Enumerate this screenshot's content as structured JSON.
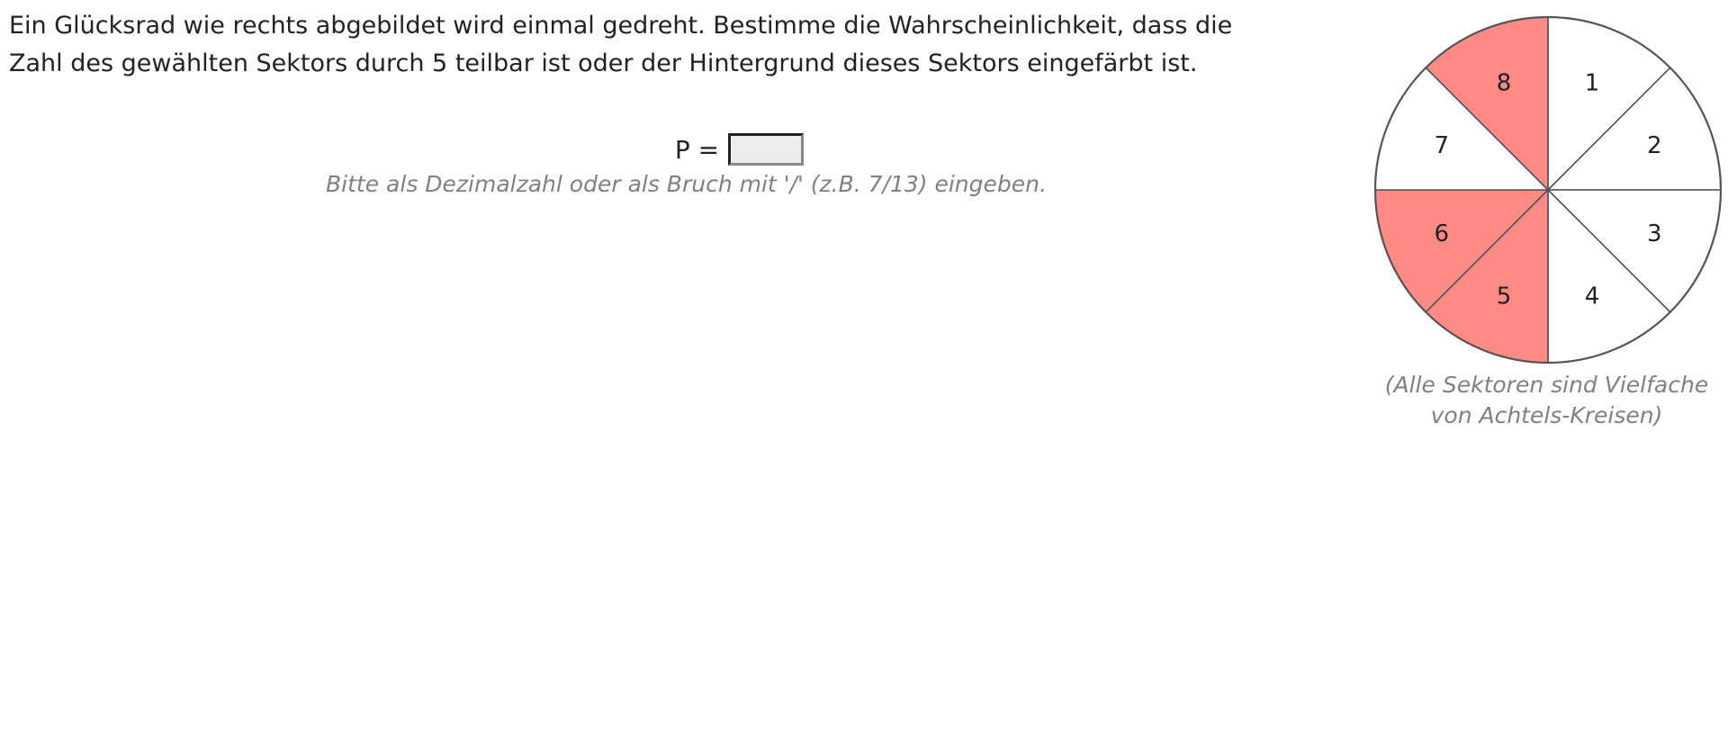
{
  "task": {
    "line1": "Ein Glücksrad wie rechts abgebildet wird einmal gedreht. Bestimme die Wahrscheinlichkeit, dass die",
    "line2": "Zahl des gewählten Sektors durch 5 teilbar ist oder der Hintergrund dieses Sektors eingefärbt ist."
  },
  "answer": {
    "label": "P =",
    "value": "",
    "hint": "Bitte als Dezimalzahl oder als Bruch mit '/' (z.B. 7/13) eingeben."
  },
  "wheel": {
    "caption_line1": "(Alle Sektoren sind Vielfache",
    "caption_line2": "von Achtels-Kreisen)",
    "fill_color": "#ff8a86",
    "sectors": [
      {
        "label": "1",
        "colored": false
      },
      {
        "label": "2",
        "colored": false
      },
      {
        "label": "3",
        "colored": false
      },
      {
        "label": "4",
        "colored": false
      },
      {
        "label": "5",
        "colored": true
      },
      {
        "label": "6",
        "colored": true
      },
      {
        "label": "7",
        "colored": false
      },
      {
        "label": "8",
        "colored": true
      }
    ]
  }
}
